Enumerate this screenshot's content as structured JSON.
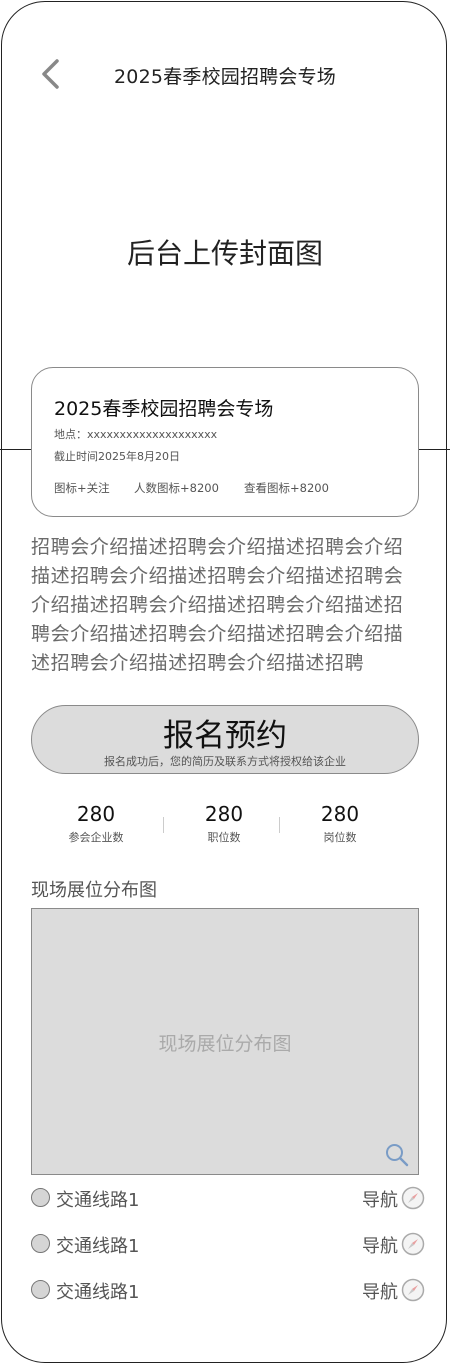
{
  "header": {
    "title": "2025春季校园招聘会专场",
    "back_icon": "chevron-left-icon"
  },
  "cover": {
    "placeholder": "后台上传封面图"
  },
  "card": {
    "title": "2025春季校园招聘会专场",
    "location": "地点：xxxxxxxxxxxxxxxxxxxx",
    "deadline": "截止时间2025年8月20日",
    "follow": "图标+关注",
    "people": "人数图标+8200",
    "views": "查看图标+8200"
  },
  "description": "招聘会介绍描述招聘会介绍描述招聘会介绍描述招聘会介绍描述招聘会介绍描述招聘会介绍描述招聘会介绍描述招聘会介绍描述招聘会介绍描述招聘会介绍描述招聘会介绍描述招聘会介绍描述招聘会介绍描述招聘",
  "signup": {
    "label": "报名预约",
    "note": "报名成功后，您的简历及联系方式将授权给该企业"
  },
  "stats": [
    {
      "value": "280",
      "label": "参会企业数"
    },
    {
      "value": "280",
      "label": "职位数"
    },
    {
      "value": "280",
      "label": "岗位数"
    }
  ],
  "map": {
    "title": "现场展位分布图",
    "placeholder": "现场展位分布图",
    "zoom_icon": "magnifier-icon"
  },
  "routes": [
    {
      "label": "交通线路1",
      "nav_label": "导航"
    },
    {
      "label": "交通线路1",
      "nav_label": "导航"
    },
    {
      "label": "交通线路1",
      "nav_label": "导航"
    }
  ],
  "colors": {
    "border": "#222222",
    "panel_gray": "#dcdcdc",
    "muted_text": "#6b6b6b",
    "accent_blue": "#7a9cc6",
    "compass_red": "#e8a0a0"
  }
}
